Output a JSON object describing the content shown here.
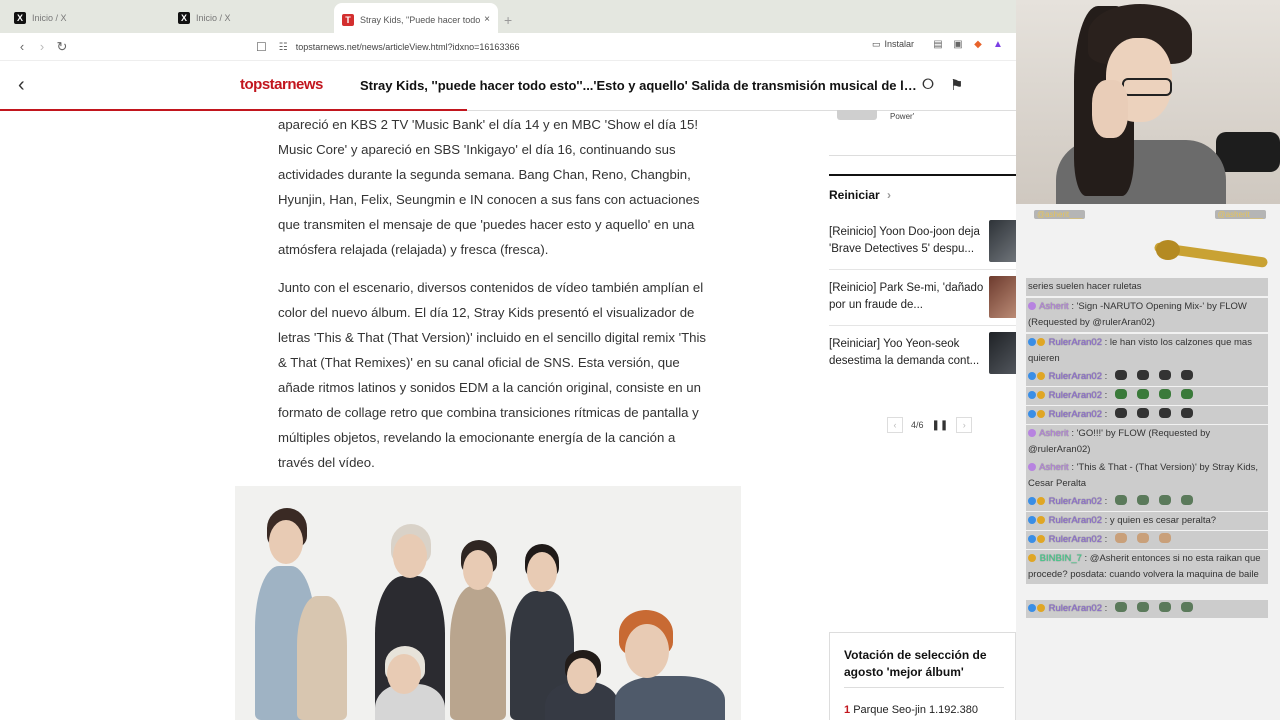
{
  "browser": {
    "tabs": [
      {
        "title": "Inicio / X",
        "favicon": "x-logo-icon",
        "active": false
      },
      {
        "title": "Inicio / X",
        "favicon": "x-logo-icon",
        "active": false
      },
      {
        "title": "Stray Kids, \"Puede hacer todo esto\"...",
        "favicon": "topstar-logo-icon",
        "active": true,
        "close": "×"
      }
    ],
    "new_tab": "+",
    "url": "topstarnews.net/news/articleView.html?idxno=16163366",
    "install_label": "Instalar"
  },
  "site": {
    "logo": "topstarnews",
    "headline": "Stray Kids, ''puede hacer todo esto''...'Esto y aquello' Salida de transmisión musical de la segunda s...",
    "reading_progress": 0.46
  },
  "article": {
    "paragraphs": [
      "apareció en KBS 2 TV 'Music Bank' el día 14 y en MBC 'Show el día 15! Music Core' y apareció en SBS 'Inkigayo' el día 16, continuando sus actividades durante la segunda semana. Bang Chan, Reno, Changbin, Hyunjin, Han, Felix, Seungmin e IN conocen a sus fans con actuaciones que transmiten el mensaje de que 'puedes hacer esto y aquello' en una atmósfera relajada (relajada) y fresca (fresca).",
      "Junto con el escenario, diversos contenidos de vídeo también amplían el color del nuevo álbum. El día 12, Stray Kids presentó el visualizador de letras 'This & That (That Version)' incluido en el sencillo digital remix 'This & That (That Remixes)' en su canal oficial de SNS. Esta versión, que añade ritmos latinos y sonidos EDM a la canción original, consiste en un formato de collage retro que combina transiciones rítmicas de pantalla y múltiples objetos, revelando la emocionante energía de la canción a través del vídeo."
    ]
  },
  "sidebar": {
    "prev_item_text": "Power'",
    "section_title": "Reiniciar",
    "items": [
      {
        "title": "[Reinicio] Yoon Doo-joon deja 'Brave Detectives 5' despu..."
      },
      {
        "title": "[Reinicio] Park Se-mi, 'dañado por un fraude de..."
      },
      {
        "title": "[Reiniciar] Yoo Yeon-seok desestima la demanda cont..."
      }
    ],
    "pager": "4/6",
    "vote": {
      "title": "Votación de selección de agosto 'mejor álbum'",
      "rank": "1",
      "entry": "Parque Seo-jin 1.192.380"
    }
  },
  "stream": {
    "chat_header_left": "@asherit___",
    "chat_header_right": "@asherit___",
    "messages": [
      {
        "user": "",
        "text": "series suelen hacer ruletas"
      },
      {
        "user": "Asherit",
        "text": ": 'Sign -NARUTO Opening Mix-' by FLOW (Requested by @rulerAran02)"
      },
      {
        "user": "RulerAran02",
        "text": ": le han visto los calzones que mas quieren"
      },
      {
        "user": "RulerAran02",
        "text": ":"
      },
      {
        "user": "RulerAran02",
        "text": ":"
      },
      {
        "user": "RulerAran02",
        "text": ":"
      },
      {
        "user": "Asherit",
        "text": ": 'GO!!!' by FLOW (Requested by @rulerAran02)"
      },
      {
        "user": "Asherit",
        "text": ": 'This & That - (That Version)' by Stray Kids, Cesar Peralta"
      },
      {
        "user": "RulerAran02",
        "text": ":"
      },
      {
        "user": "RulerAran02",
        "text": ": y quien es cesar peralta?"
      },
      {
        "user": "RulerAran02",
        "text": ":"
      },
      {
        "user": "BINBIN_7",
        "text": ": @Asherit entonces si no esta raikan que procede? posdata: cuando volvera la maquina de baile"
      },
      {
        "user": "RulerAran02",
        "text": ":"
      }
    ]
  },
  "colors": {
    "brand": "#c2161e",
    "ruler": "#8e6bd6",
    "asherit": "#b783e0",
    "binbin": "#3fd28c"
  }
}
